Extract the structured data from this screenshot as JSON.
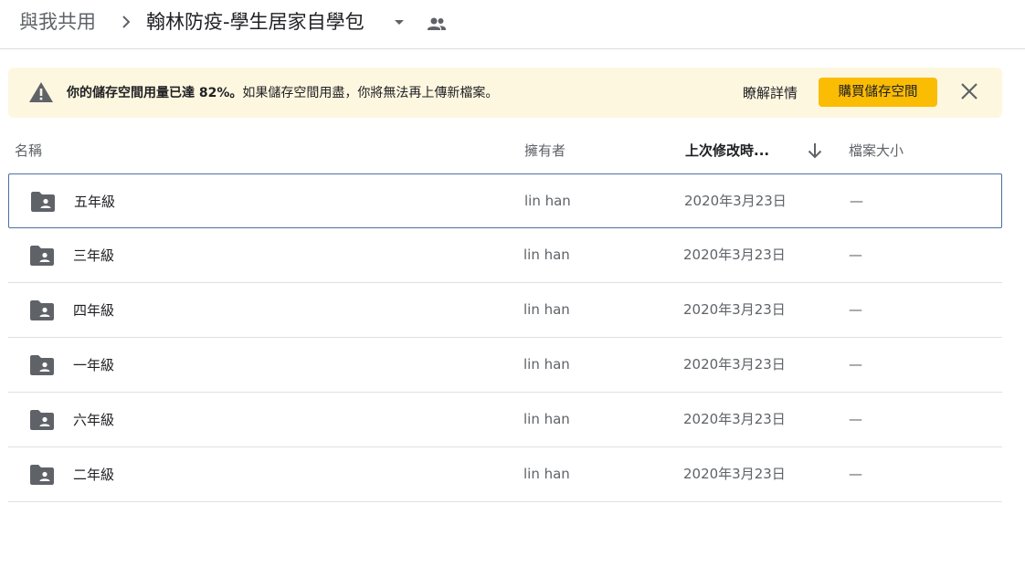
{
  "breadcrumb": {
    "root": "與我共用",
    "current": "翰林防疫-學生居家自學包"
  },
  "banner": {
    "bold_text": "你的儲存空間用量已達 82%。",
    "text": "如果儲存空間用盡，你將無法再上傳新檔案。",
    "learn_more": "瞭解詳情",
    "buy_button": "購買儲存空間"
  },
  "columns": {
    "name": "名稱",
    "owner": "擁有者",
    "modified": "上次修改時...",
    "size": "檔案大小"
  },
  "files": [
    {
      "name": "五年級",
      "owner": "lin han",
      "modified": "2020年3月23日",
      "size": "—"
    },
    {
      "name": "三年級",
      "owner": "lin han",
      "modified": "2020年3月23日",
      "size": "—"
    },
    {
      "name": "四年級",
      "owner": "lin han",
      "modified": "2020年3月23日",
      "size": "—"
    },
    {
      "name": "一年級",
      "owner": "lin han",
      "modified": "2020年3月23日",
      "size": "—"
    },
    {
      "name": "六年級",
      "owner": "lin han",
      "modified": "2020年3月23日",
      "size": "—"
    },
    {
      "name": "二年級",
      "owner": "lin han",
      "modified": "2020年3月23日",
      "size": "—"
    }
  ],
  "colors": {
    "banner_bg": "#fef7e0",
    "buy_button": "#fbbc04",
    "selected_border": "#4a6fa0"
  }
}
